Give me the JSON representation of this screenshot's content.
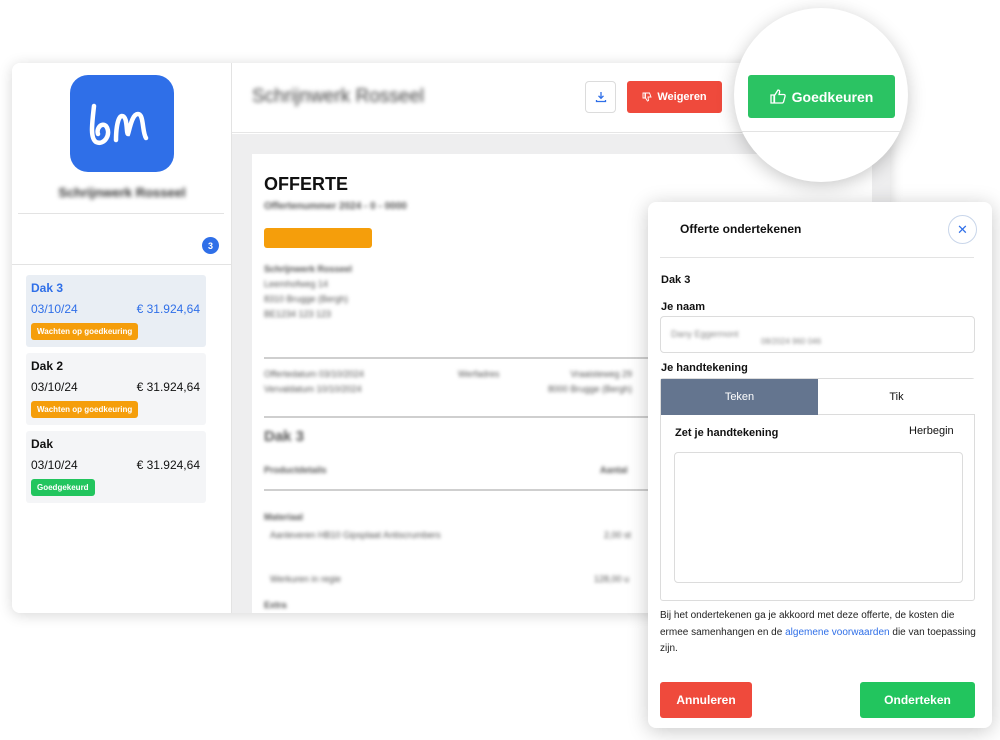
{
  "sidebar": {
    "company_name": "Schrijnwerk Rosseel",
    "count_badge": "3",
    "quotes": [
      {
        "title": "Dak 3",
        "date": "03/10/24",
        "amount": "€ 31.924,64",
        "status": "Wachten op goedkeuring",
        "status_color": "#f59e0b",
        "active": true
      },
      {
        "title": "Dak 2",
        "date": "03/10/24",
        "amount": "€ 31.924,64",
        "status": "Wachten op goedkeuring",
        "status_color": "#f59e0b",
        "active": false
      },
      {
        "title": "Dak",
        "date": "03/10/24",
        "amount": "€ 31.924,64",
        "status": "Goedgekeurd",
        "status_color": "#22c55e",
        "active": false
      }
    ]
  },
  "topbar": {
    "title": "Schrijnwerk Rosseel",
    "download_icon": "download-icon",
    "reject_label": "Weigeren",
    "approve_label": "Goedkeuren"
  },
  "document": {
    "heading": "OFFERTE",
    "number": "Offertenummer 2024 - 0 - 0000",
    "company": "Schrijnwerk Rosseel",
    "address_line1": "Leemhofweg 14",
    "address_line2": "8310 Brugge (Bergh)",
    "address_line3": "BE1234 123 123",
    "offer_date": "Offertedatum   03/10/2024",
    "expiry_date": "Vervaldatum   10/10/2024",
    "client_label": "Werfadres",
    "client_street": "Vraaisteweg 29",
    "client_city": "8000 Brugge (Bergh)",
    "section": "Dak 3",
    "col_product": "Productdetails",
    "col_qty": "Aantal",
    "group1": "Materiaal",
    "item1": "Aanleveren HB10 Gipsplaat Antiscrumbers",
    "item1_qty": "2,00 st",
    "item2": "Werkuren in regie",
    "item2_qty": "128,00 u",
    "group2": "Extra"
  },
  "modal": {
    "title": "Offerte ondertekenen",
    "quote": "Dak 3",
    "name_label": "Je naam",
    "name_value": "Dany Eggermont",
    "name_sub": "08/2024 960 046",
    "signature_label": "Je handtekening",
    "tab_draw": "Teken",
    "tab_type": "Tik",
    "pad_label": "Zet je handtekening",
    "restart": "Herbegin",
    "consent_before": "Bij het ondertekenen ga je akkoord met deze offerte, de kosten die ermee samenhangen en de ",
    "consent_link": "algemene voorwaarden",
    "consent_after": " die van toepassing zijn.",
    "cancel_label": "Annuleren",
    "sign_label": "Onderteken"
  },
  "colors": {
    "brand": "#2f6fe8",
    "reject": "#ef4a3c",
    "approve": "#2bc363",
    "pending": "#f59e0b",
    "tab_active": "#64758f"
  }
}
